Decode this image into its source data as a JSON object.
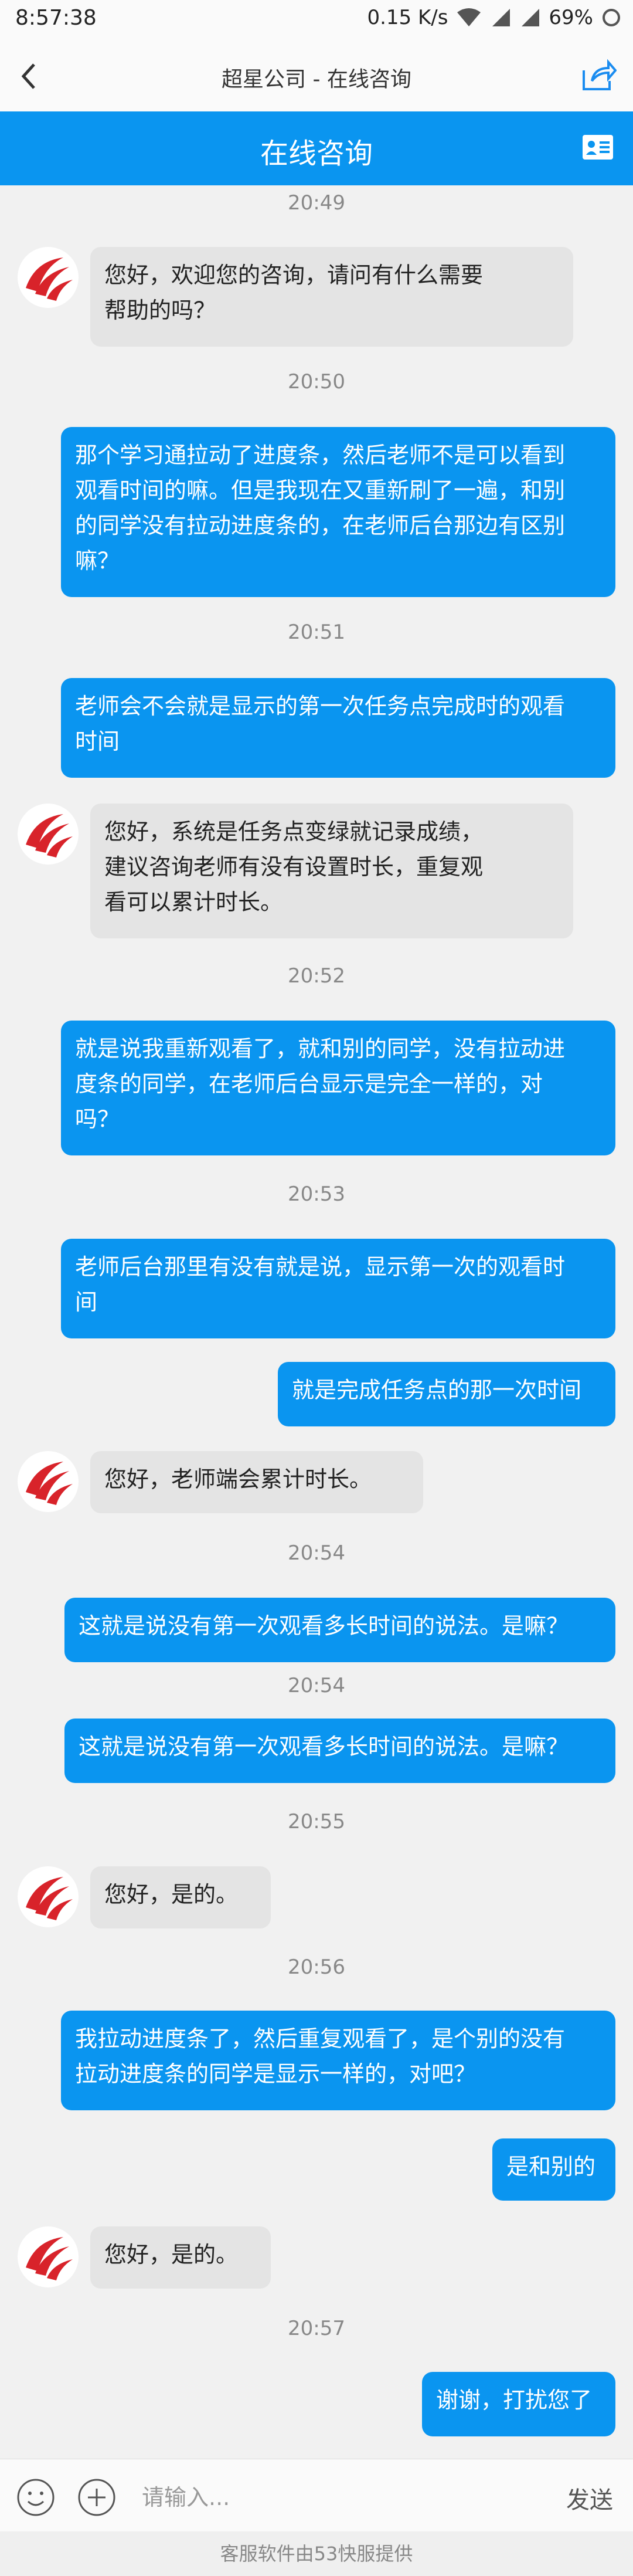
{
  "status": {
    "time": "8:57:38",
    "speed": "0.15 K/s",
    "battery": "69%"
  },
  "header": {
    "title": "超星公司 - 在线咨询"
  },
  "bar": {
    "title": "在线咨询"
  },
  "messages": [
    {
      "type": "time",
      "text": "20:49"
    },
    {
      "type": "left",
      "text": "您好，欢迎您的咨询，请问有什么需要\n帮助的吗？"
    },
    {
      "type": "time",
      "text": "20:50"
    },
    {
      "type": "right",
      "text": "那个学习通拉动了进度条，然后老师不是可以看到\n观看时间的嘛。但是我现在又重新刷了一遍，和别\n的同学没有拉动进度条的，在老师后台那边有区别\n嘛？"
    },
    {
      "type": "time",
      "text": "20:51"
    },
    {
      "type": "right",
      "text": "老师会不会就是显示的第一次任务点完成时的观看\n时间"
    },
    {
      "type": "left",
      "text": "您好，系统是任务点变绿就记录成绩，\n建议咨询老师有没有设置时长，重复观\n看可以累计时长。"
    },
    {
      "type": "time",
      "text": "20:52"
    },
    {
      "type": "right",
      "text": "就是说我重新观看了，就和别的同学，没有拉动进\n度条的同学，在老师后台显示是完全一样的，对\n吗？"
    },
    {
      "type": "time",
      "text": "20:53"
    },
    {
      "type": "right",
      "text": "老师后台那里有没有就是说，显示第一次的观看时\n间"
    },
    {
      "type": "right",
      "text": "就是完成任务点的那一次时间"
    },
    {
      "type": "left",
      "text": "您好，老师端会累计时长。"
    },
    {
      "type": "time",
      "text": "20:54"
    },
    {
      "type": "right",
      "text": "这就是说没有第一次观看多长时间的说法。是嘛？"
    },
    {
      "type": "time",
      "text": "20:54"
    },
    {
      "type": "right",
      "text": "这就是说没有第一次观看多长时间的说法。是嘛？"
    },
    {
      "type": "time",
      "text": "20:55"
    },
    {
      "type": "left",
      "text": "您好，是的。"
    },
    {
      "type": "time",
      "text": "20:56"
    },
    {
      "type": "right",
      "text": "我拉动进度条了，然后重复观看了，是个别的没有\n拉动进度条的同学是显示一样的，对吧？"
    },
    {
      "type": "right",
      "text": "是和别的"
    },
    {
      "type": "left",
      "text": "您好，是的。"
    },
    {
      "type": "time",
      "text": "20:57"
    },
    {
      "type": "right",
      "text": "谢谢，打扰您了"
    }
  ],
  "input": {
    "placeholder": "请输入...",
    "send": "发送"
  },
  "footer": {
    "text": "客服软件由53快服提供"
  }
}
